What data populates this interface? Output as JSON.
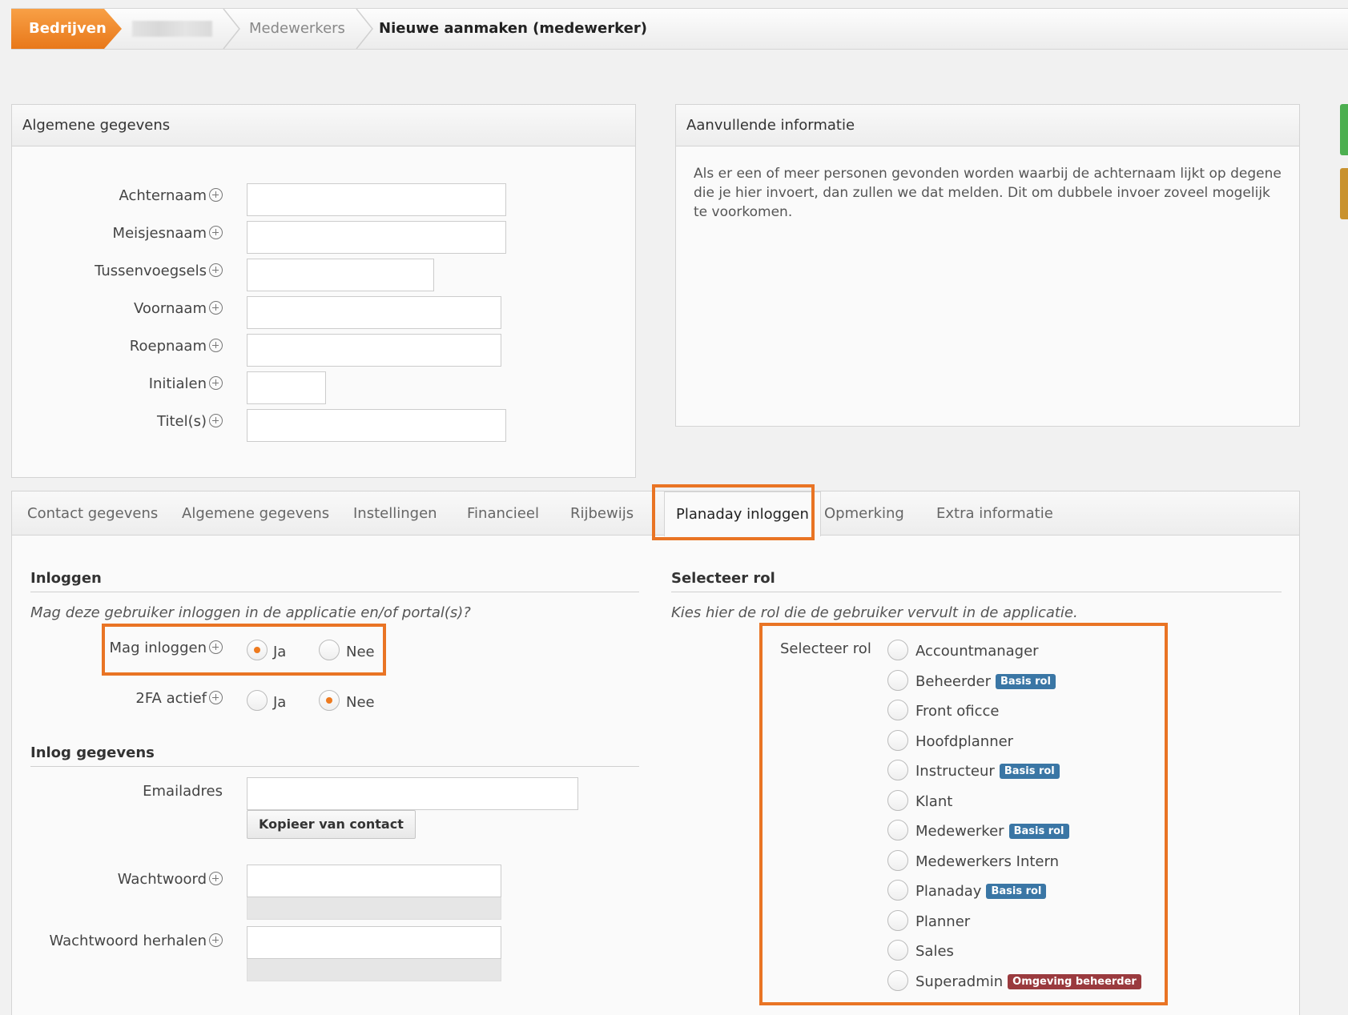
{
  "breadcrumb": {
    "home": "Bedrijven",
    "level2": "Medewerkers",
    "current": "Nieuwe aanmaken (medewerker)"
  },
  "general_panel": {
    "title": "Algemene gegevens",
    "fields": [
      {
        "label": "Achternaam",
        "value": ""
      },
      {
        "label": "Meisjesnaam",
        "value": ""
      },
      {
        "label": "Tussenvoegsels",
        "value": ""
      },
      {
        "label": "Voornaam",
        "value": ""
      },
      {
        "label": "Roepnaam",
        "value": ""
      },
      {
        "label": "Initialen",
        "value": ""
      },
      {
        "label": "Titel(s)",
        "value": ""
      }
    ]
  },
  "extra_panel": {
    "title": "Aanvullende informatie",
    "text": "Als er een of meer personen gevonden worden waarbij de achternaam lijkt op degene die je hier invoert, dan zullen we dat melden. Dit om dubbele invoer zoveel mogelijk te voorkomen."
  },
  "tabs": [
    {
      "label": "Contact gegevens",
      "active": false
    },
    {
      "label": "Algemene gegevens",
      "active": false
    },
    {
      "label": "Instellingen",
      "active": false
    },
    {
      "label": "Financieel",
      "active": false
    },
    {
      "label": "Rijbewijs",
      "active": false
    },
    {
      "label": "Planaday inloggen",
      "active": true
    },
    {
      "label": "Opmerking",
      "active": false
    },
    {
      "label": "Extra informatie",
      "active": false
    }
  ],
  "login": {
    "section_title": "Inloggen",
    "question": "Mag deze gebruiker inloggen in de applicatie en/of portal(s)?",
    "may_login": {
      "label": "Mag inloggen",
      "yes": "Ja",
      "no": "Nee",
      "selected": "Ja"
    },
    "twofa": {
      "label": "2FA actief",
      "yes": "Ja",
      "no": "Nee",
      "selected": "Nee"
    }
  },
  "login_details": {
    "section_title": "Inlog gegevens",
    "email_label": "Emailadres",
    "email_value": "",
    "copy_button": "Kopieer van contact",
    "password_label": "Wachtwoord",
    "password_repeat_label": "Wachtwoord herhalen"
  },
  "role": {
    "section_title": "Selecteer rol",
    "note": "Kies hier de rol die de gebruiker vervult in de applicatie.",
    "field_label": "Selecteer rol",
    "options": [
      {
        "name": "Accountmanager",
        "badge": ""
      },
      {
        "name": "Beheerder",
        "badge": "Basis rol"
      },
      {
        "name": "Front oficce",
        "badge": ""
      },
      {
        "name": "Hoofdplanner",
        "badge": ""
      },
      {
        "name": "Instructeur",
        "badge": "Basis rol"
      },
      {
        "name": "Klant",
        "badge": ""
      },
      {
        "name": "Medewerker",
        "badge": "Basis rol"
      },
      {
        "name": "Medewerkers Intern",
        "badge": ""
      },
      {
        "name": "Planaday",
        "badge": "Basis rol"
      },
      {
        "name": "Planner",
        "badge": ""
      },
      {
        "name": "Sales",
        "badge": ""
      },
      {
        "name": "Superadmin",
        "badge": "Omgeving beheerder"
      }
    ]
  },
  "colors": {
    "accent": "#e97424",
    "badge_basis": "#3a76a5",
    "badge_omgeving": "#9a3a3e"
  }
}
